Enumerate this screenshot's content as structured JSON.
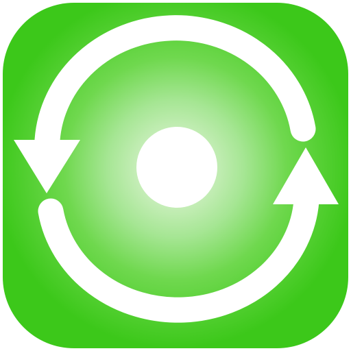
{
  "icon": {
    "name": "sync-refresh-app-icon",
    "glyph": "sync-arrows-icon",
    "colors": {
      "tile_base": "#4fd02b",
      "tile_edge": "#3cc81a",
      "glow_inner": "#dff5d6",
      "glow_mid": "#a6e694",
      "glyph": "#ffffff"
    }
  }
}
